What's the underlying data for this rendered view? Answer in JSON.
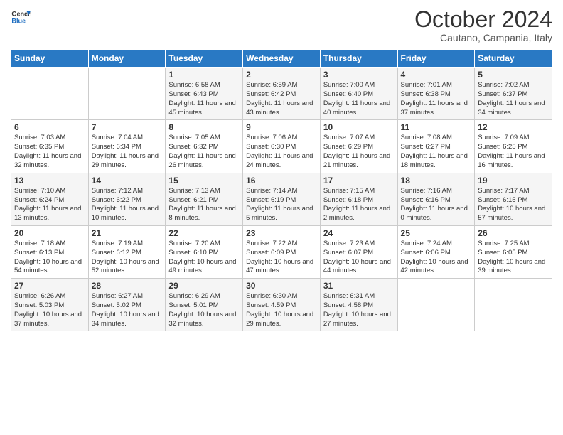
{
  "logo": {
    "line1": "General",
    "line2": "Blue"
  },
  "title": "October 2024",
  "subtitle": "Cautano, Campania, Italy",
  "days_of_week": [
    "Sunday",
    "Monday",
    "Tuesday",
    "Wednesday",
    "Thursday",
    "Friday",
    "Saturday"
  ],
  "weeks": [
    [
      {
        "day": "",
        "sunrise": "",
        "sunset": "",
        "daylight": ""
      },
      {
        "day": "",
        "sunrise": "",
        "sunset": "",
        "daylight": ""
      },
      {
        "day": "1",
        "sunrise": "Sunrise: 6:58 AM",
        "sunset": "Sunset: 6:43 PM",
        "daylight": "Daylight: 11 hours and 45 minutes."
      },
      {
        "day": "2",
        "sunrise": "Sunrise: 6:59 AM",
        "sunset": "Sunset: 6:42 PM",
        "daylight": "Daylight: 11 hours and 43 minutes."
      },
      {
        "day": "3",
        "sunrise": "Sunrise: 7:00 AM",
        "sunset": "Sunset: 6:40 PM",
        "daylight": "Daylight: 11 hours and 40 minutes."
      },
      {
        "day": "4",
        "sunrise": "Sunrise: 7:01 AM",
        "sunset": "Sunset: 6:38 PM",
        "daylight": "Daylight: 11 hours and 37 minutes."
      },
      {
        "day": "5",
        "sunrise": "Sunrise: 7:02 AM",
        "sunset": "Sunset: 6:37 PM",
        "daylight": "Daylight: 11 hours and 34 minutes."
      }
    ],
    [
      {
        "day": "6",
        "sunrise": "Sunrise: 7:03 AM",
        "sunset": "Sunset: 6:35 PM",
        "daylight": "Daylight: 11 hours and 32 minutes."
      },
      {
        "day": "7",
        "sunrise": "Sunrise: 7:04 AM",
        "sunset": "Sunset: 6:34 PM",
        "daylight": "Daylight: 11 hours and 29 minutes."
      },
      {
        "day": "8",
        "sunrise": "Sunrise: 7:05 AM",
        "sunset": "Sunset: 6:32 PM",
        "daylight": "Daylight: 11 hours and 26 minutes."
      },
      {
        "day": "9",
        "sunrise": "Sunrise: 7:06 AM",
        "sunset": "Sunset: 6:30 PM",
        "daylight": "Daylight: 11 hours and 24 minutes."
      },
      {
        "day": "10",
        "sunrise": "Sunrise: 7:07 AM",
        "sunset": "Sunset: 6:29 PM",
        "daylight": "Daylight: 11 hours and 21 minutes."
      },
      {
        "day": "11",
        "sunrise": "Sunrise: 7:08 AM",
        "sunset": "Sunset: 6:27 PM",
        "daylight": "Daylight: 11 hours and 18 minutes."
      },
      {
        "day": "12",
        "sunrise": "Sunrise: 7:09 AM",
        "sunset": "Sunset: 6:25 PM",
        "daylight": "Daylight: 11 hours and 16 minutes."
      }
    ],
    [
      {
        "day": "13",
        "sunrise": "Sunrise: 7:10 AM",
        "sunset": "Sunset: 6:24 PM",
        "daylight": "Daylight: 11 hours and 13 minutes."
      },
      {
        "day": "14",
        "sunrise": "Sunrise: 7:12 AM",
        "sunset": "Sunset: 6:22 PM",
        "daylight": "Daylight: 11 hours and 10 minutes."
      },
      {
        "day": "15",
        "sunrise": "Sunrise: 7:13 AM",
        "sunset": "Sunset: 6:21 PM",
        "daylight": "Daylight: 11 hours and 8 minutes."
      },
      {
        "day": "16",
        "sunrise": "Sunrise: 7:14 AM",
        "sunset": "Sunset: 6:19 PM",
        "daylight": "Daylight: 11 hours and 5 minutes."
      },
      {
        "day": "17",
        "sunrise": "Sunrise: 7:15 AM",
        "sunset": "Sunset: 6:18 PM",
        "daylight": "Daylight: 11 hours and 2 minutes."
      },
      {
        "day": "18",
        "sunrise": "Sunrise: 7:16 AM",
        "sunset": "Sunset: 6:16 PM",
        "daylight": "Daylight: 11 hours and 0 minutes."
      },
      {
        "day": "19",
        "sunrise": "Sunrise: 7:17 AM",
        "sunset": "Sunset: 6:15 PM",
        "daylight": "Daylight: 10 hours and 57 minutes."
      }
    ],
    [
      {
        "day": "20",
        "sunrise": "Sunrise: 7:18 AM",
        "sunset": "Sunset: 6:13 PM",
        "daylight": "Daylight: 10 hours and 54 minutes."
      },
      {
        "day": "21",
        "sunrise": "Sunrise: 7:19 AM",
        "sunset": "Sunset: 6:12 PM",
        "daylight": "Daylight: 10 hours and 52 minutes."
      },
      {
        "day": "22",
        "sunrise": "Sunrise: 7:20 AM",
        "sunset": "Sunset: 6:10 PM",
        "daylight": "Daylight: 10 hours and 49 minutes."
      },
      {
        "day": "23",
        "sunrise": "Sunrise: 7:22 AM",
        "sunset": "Sunset: 6:09 PM",
        "daylight": "Daylight: 10 hours and 47 minutes."
      },
      {
        "day": "24",
        "sunrise": "Sunrise: 7:23 AM",
        "sunset": "Sunset: 6:07 PM",
        "daylight": "Daylight: 10 hours and 44 minutes."
      },
      {
        "day": "25",
        "sunrise": "Sunrise: 7:24 AM",
        "sunset": "Sunset: 6:06 PM",
        "daylight": "Daylight: 10 hours and 42 minutes."
      },
      {
        "day": "26",
        "sunrise": "Sunrise: 7:25 AM",
        "sunset": "Sunset: 6:05 PM",
        "daylight": "Daylight: 10 hours and 39 minutes."
      }
    ],
    [
      {
        "day": "27",
        "sunrise": "Sunrise: 6:26 AM",
        "sunset": "Sunset: 5:03 PM",
        "daylight": "Daylight: 10 hours and 37 minutes."
      },
      {
        "day": "28",
        "sunrise": "Sunrise: 6:27 AM",
        "sunset": "Sunset: 5:02 PM",
        "daylight": "Daylight: 10 hours and 34 minutes."
      },
      {
        "day": "29",
        "sunrise": "Sunrise: 6:29 AM",
        "sunset": "Sunset: 5:01 PM",
        "daylight": "Daylight: 10 hours and 32 minutes."
      },
      {
        "day": "30",
        "sunrise": "Sunrise: 6:30 AM",
        "sunset": "Sunset: 4:59 PM",
        "daylight": "Daylight: 10 hours and 29 minutes."
      },
      {
        "day": "31",
        "sunrise": "Sunrise: 6:31 AM",
        "sunset": "Sunset: 4:58 PM",
        "daylight": "Daylight: 10 hours and 27 minutes."
      },
      {
        "day": "",
        "sunrise": "",
        "sunset": "",
        "daylight": ""
      },
      {
        "day": "",
        "sunrise": "",
        "sunset": "",
        "daylight": ""
      }
    ]
  ]
}
